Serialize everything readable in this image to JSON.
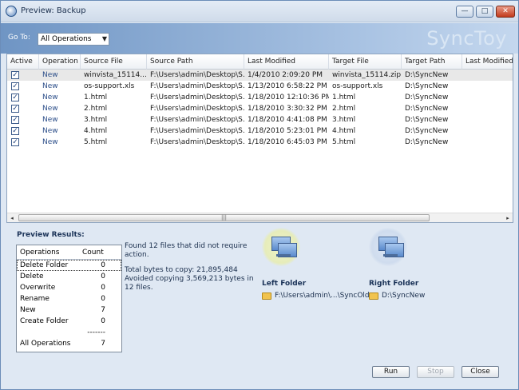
{
  "window": {
    "title": "Preview: Backup",
    "minimize": "—",
    "maximize": "□",
    "close": "✕"
  },
  "goto": {
    "label": "Go To:",
    "selected": "All Operations",
    "arrow": "▼"
  },
  "brand": "SyncToy",
  "grid": {
    "columns": [
      "Active",
      "Operation",
      "Source File",
      "Source Path",
      "Last Modified",
      "Target File",
      "Target Path",
      "Last Modified"
    ],
    "rows": [
      {
        "active": "✓",
        "operation": "New",
        "source_file": "winvista_15114....",
        "source_path": "F:\\Users\\admin\\Desktop\\S...",
        "last_modified": "1/4/2010 2:09:20 PM",
        "target_file": "winvista_15114.zip",
        "target_path": "D:\\SyncNew"
      },
      {
        "active": "✓",
        "operation": "New",
        "source_file": "os-support.xls",
        "source_path": "F:\\Users\\admin\\Desktop\\S...",
        "last_modified": "1/13/2010 6:58:22 PM",
        "target_file": "os-support.xls",
        "target_path": "D:\\SyncNew"
      },
      {
        "active": "✓",
        "operation": "New",
        "source_file": "1.html",
        "source_path": "F:\\Users\\admin\\Desktop\\S...",
        "last_modified": "1/18/2010 12:10:36 PM",
        "target_file": "1.html",
        "target_path": "D:\\SyncNew"
      },
      {
        "active": "✓",
        "operation": "New",
        "source_file": "2.html",
        "source_path": "F:\\Users\\admin\\Desktop\\S...",
        "last_modified": "1/18/2010 3:30:32 PM",
        "target_file": "2.html",
        "target_path": "D:\\SyncNew"
      },
      {
        "active": "✓",
        "operation": "New",
        "source_file": "3.html",
        "source_path": "F:\\Users\\admin\\Desktop\\S...",
        "last_modified": "1/18/2010 4:41:08 PM",
        "target_file": "3.html",
        "target_path": "D:\\SyncNew"
      },
      {
        "active": "✓",
        "operation": "New",
        "source_file": "4.html",
        "source_path": "F:\\Users\\admin\\Desktop\\S...",
        "last_modified": "1/18/2010 5:23:01 PM",
        "target_file": "4.html",
        "target_path": "D:\\SyncNew"
      },
      {
        "active": "✓",
        "operation": "New",
        "source_file": "5.html",
        "source_path": "F:\\Users\\admin\\Desktop\\S...",
        "last_modified": "1/18/2010 6:45:03 PM",
        "target_file": "5.html",
        "target_path": "D:\\SyncNew"
      }
    ],
    "scroll_left": "◂",
    "scroll_right": "▸",
    "scroll_grip": "|||"
  },
  "results": {
    "title": "Preview Results:",
    "table_headers": [
      "Operations",
      "Count"
    ],
    "operations": [
      {
        "name": "Delete Folder",
        "count": "0"
      },
      {
        "name": "Delete",
        "count": "0"
      },
      {
        "name": "Overwrite",
        "count": "0"
      },
      {
        "name": "Rename",
        "count": "0"
      },
      {
        "name": "New",
        "count": "7"
      },
      {
        "name": "Create Folder",
        "count": "0"
      },
      {
        "name": "",
        "count": "-------"
      },
      {
        "name": "All Operations",
        "count": "7"
      }
    ],
    "summary": [
      "Found 12 files that did not require action.",
      "Total bytes to copy: 21,895,484",
      "Avoided copying 3,569,213 bytes in 12 files."
    ]
  },
  "left_folder": {
    "title": "Left Folder",
    "path": "F:\\Users\\admin\\...\\SyncOld"
  },
  "right_folder": {
    "title": "Right Folder",
    "path": "D:\\SyncNew"
  },
  "buttons": {
    "run": "Run",
    "stop": "Stop",
    "close": "Close"
  },
  "colors": {
    "accent": "#6f95c4",
    "heading": "#1b3358",
    "operation_text": "#2d4f8a"
  }
}
